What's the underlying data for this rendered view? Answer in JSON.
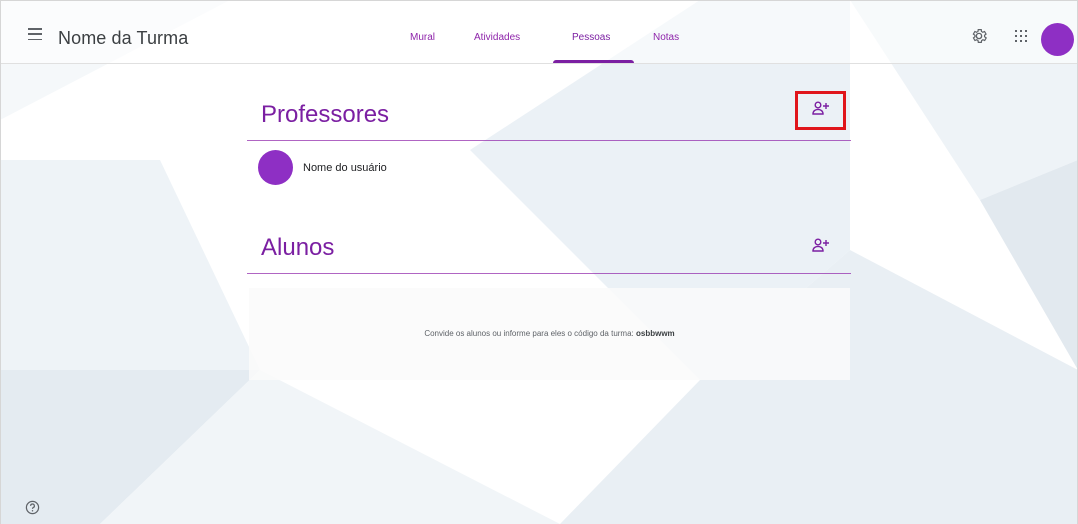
{
  "header": {
    "class_name": "Nome da Turma",
    "tabs": [
      {
        "label": "Mural",
        "active": false
      },
      {
        "label": "Atividades",
        "active": false
      },
      {
        "label": "Pessoas",
        "active": true
      },
      {
        "label": "Notas",
        "active": false
      }
    ],
    "icons": [
      "menu-icon",
      "gear-icon",
      "apps-grid-icon",
      "account-avatar"
    ]
  },
  "teachers_section": {
    "title": "Professores",
    "add_icon": "person-add-icon",
    "members": [
      {
        "name": "Nome do usuário"
      }
    ]
  },
  "students_section": {
    "title": "Alunos",
    "add_icon": "person-add-icon",
    "invite_text": "Convide os alunos ou informe para eles o código da turma:",
    "class_code": "osbbwwm"
  },
  "footer": {
    "help_icon": "help-circle-icon"
  },
  "colors": {
    "accent": "#7b1fa2",
    "avatar": "#8e2fc4",
    "highlight": "#e0151b",
    "background_shape": "#e8eef3"
  }
}
